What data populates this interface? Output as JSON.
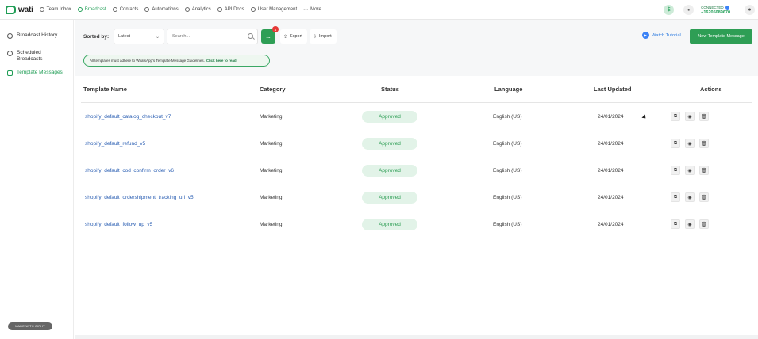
{
  "app": {
    "logo_text": "wati",
    "colors": {
      "accent": "#1f9d55",
      "link": "#2b5fb3",
      "pill_bg": "#e2f3e8",
      "badge": "#e53935"
    }
  },
  "nav": {
    "items": [
      {
        "label": "Team Inbox",
        "icon": "inbox-icon"
      },
      {
        "label": "Broadcast",
        "icon": "broadcast-icon",
        "active": true
      },
      {
        "label": "Contacts",
        "icon": "contacts-icon"
      },
      {
        "label": "Automations",
        "icon": "automation-icon"
      },
      {
        "label": "Analytics",
        "icon": "analytics-icon"
      },
      {
        "label": "API Docs",
        "icon": "api-icon"
      },
      {
        "label": "User Management",
        "icon": "user-icon"
      },
      {
        "label": "More",
        "icon": "more-icon"
      }
    ],
    "connected_label": "CONNECTED",
    "phone": "+16205089670"
  },
  "sidebar": {
    "items": [
      {
        "label": "Broadcast History",
        "icon": "history-icon"
      },
      {
        "label": "Scheduled Broadcasts",
        "icon": "schedule-icon"
      },
      {
        "label": "Template Messages",
        "icon": "template-icon",
        "active": true
      }
    ],
    "made_with": "MADE WITH GIPHY"
  },
  "toolbar": {
    "sorted_label": "Sorted by:",
    "sort_value": "Latest",
    "search_placeholder": "Search...",
    "filter_badge": "4",
    "export_label": "Export",
    "import_label": "Import",
    "watch_label": "Watch Tutorial",
    "new_template_label": "New Template Message",
    "notice_text": "All templates must adhere to WhatsApp's Template Message Guidelines.",
    "notice_link": "Click here to read"
  },
  "table": {
    "headers": [
      "Template Name",
      "Category",
      "Status",
      "Language",
      "Last Updated",
      "Actions"
    ],
    "rows": [
      {
        "name": "shopify_default_catalog_checkout_v7",
        "category": "Marketing",
        "status": "Approved",
        "language": "English (US)",
        "updated": "24/01/2024"
      },
      {
        "name": "shopify_default_refund_v5",
        "category": "Marketing",
        "status": "Approved",
        "language": "English (US)",
        "updated": "24/01/2024"
      },
      {
        "name": "shopify_default_cod_confirm_order_v6",
        "category": "Marketing",
        "status": "Approved",
        "language": "English (US)",
        "updated": "24/01/2024"
      },
      {
        "name": "shopify_default_ordershipment_tracking_url_v5",
        "category": "Marketing",
        "status": "Approved",
        "language": "English (US)",
        "updated": "24/01/2024"
      },
      {
        "name": "shopify_default_follow_up_v5",
        "category": "Marketing",
        "status": "Approved",
        "language": "English (US)",
        "updated": "24/01/2024"
      }
    ]
  }
}
